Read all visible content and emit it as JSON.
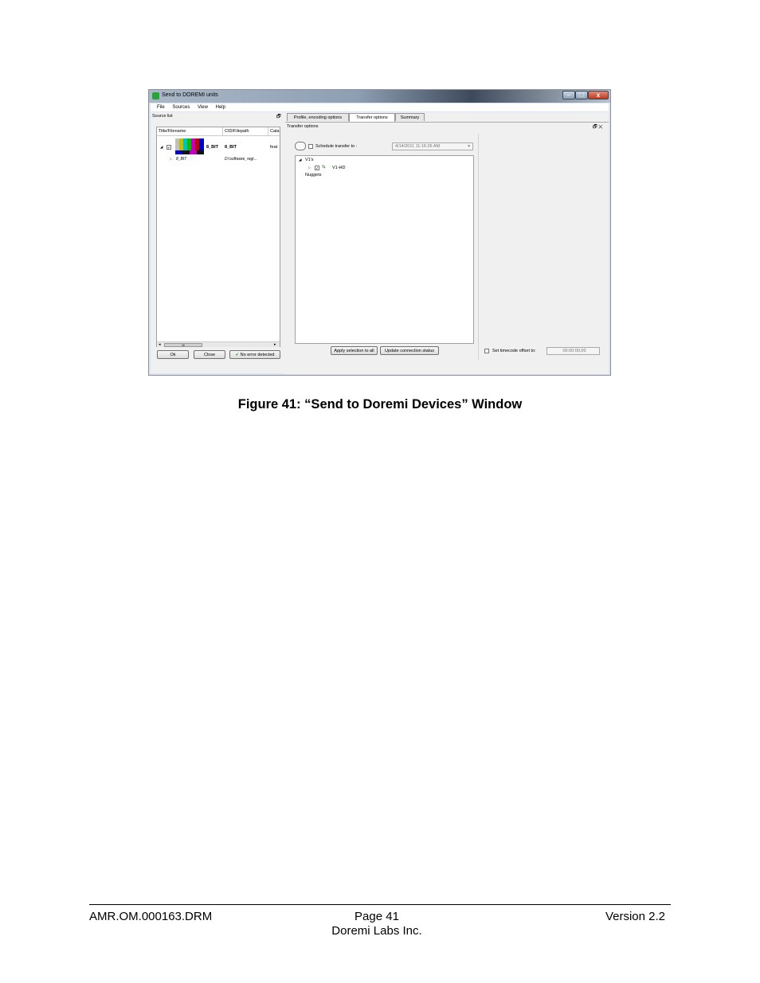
{
  "screenshot": {
    "window_title": "Send to DOREMI units",
    "window_buttons": {
      "minimize": "–",
      "maximize": "□",
      "close": "x"
    },
    "menu": [
      "File",
      "Sources",
      "View",
      "Help"
    ],
    "source_list": {
      "title": "Source list",
      "dock_glyph": "🗗",
      "columns": [
        "Title/Filename",
        "CID/Filepath",
        "Cata"
      ],
      "rows": [
        {
          "expander": "◢",
          "checked": "✓",
          "title": "8_BIT",
          "cid": "8_BIT",
          "cata": "feat"
        },
        {
          "expander": "▷",
          "title": "8_BIT",
          "cid": "D:\\software_regr..."
        }
      ],
      "scroll_left": "◂",
      "scroll_right": "▸",
      "scroll_thumb": "III"
    },
    "buttons": {
      "ok": "Ok",
      "close": "Close",
      "status": "No error detected",
      "status_icon": "✔"
    },
    "tabs": [
      "Profile, encoding options",
      "Transfer options",
      "Summary"
    ],
    "transfer_options": {
      "title": "Transfer options",
      "dock_glyphs": "🗗 ✕",
      "schedule_label": "Schedule transfer to :",
      "schedule_value": "4/14/2011 11:16:26 AM",
      "combo_arrow": "▾",
      "tree": {
        "group_expander": "◢",
        "group": "V1's",
        "item_expander": "▷",
        "item_checked": "✓",
        "item_icon": "⇆",
        "item": "V1-HD",
        "other": "Nuggets"
      },
      "apply_button": "Apply selection to all",
      "update_button": "Update connection status"
    },
    "timecode": {
      "label": "Set timecode offset to:",
      "value": "00:00:00,00"
    }
  },
  "caption": "Figure 41: “Send to Doremi Devices” Window",
  "footer": {
    "doc_id": "AMR.OM.000163.DRM",
    "page": "Page 41",
    "company": "Doremi Labs Inc.",
    "version": "Version 2.2"
  }
}
